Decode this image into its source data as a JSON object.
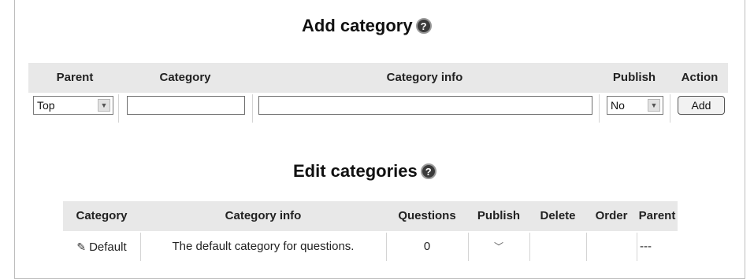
{
  "add_section": {
    "title": "Add category",
    "help_icon": "help-icon",
    "columns": [
      "Parent",
      "Category",
      "Category info",
      "Publish",
      "Action"
    ],
    "parent_select_value": "Top",
    "category_input_value": "",
    "category_info_input_value": "",
    "publish_select_value": "No",
    "action_button_label": "Add"
  },
  "edit_section": {
    "title": "Edit categories",
    "help_icon": "help-icon",
    "columns": [
      "Category",
      "Category info",
      "Questions",
      "Publish",
      "Delete",
      "Order",
      "Parent"
    ],
    "rows": [
      {
        "edit_icon": "edit-icon",
        "category": "Default",
        "info": "The default category for questions.",
        "questions": "0",
        "publish_icon": "tick-icon",
        "delete": "",
        "order": "",
        "parent": "---"
      }
    ]
  }
}
